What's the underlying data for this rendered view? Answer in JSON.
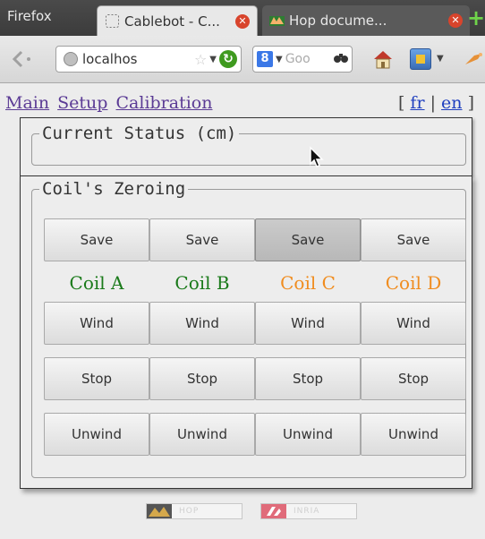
{
  "browser": {
    "app_title": "Firefox",
    "tabs": [
      {
        "label": "Cablebot - C...",
        "active": true
      },
      {
        "label": "Hop docume...",
        "active": false
      }
    ],
    "url": "localhos",
    "search_placeholder": "Goo"
  },
  "nav": {
    "links": [
      "Main",
      "Setup",
      "Calibration"
    ],
    "lang_open": "[",
    "lang_sep": "|",
    "lang_close": "]",
    "langs": [
      "fr",
      "en"
    ]
  },
  "status": {
    "legend": "Current Status (cm)"
  },
  "zeroing": {
    "legend": "Coil's Zeroing",
    "save_label": "Save",
    "wind_label": "Wind",
    "stop_label": "Stop",
    "unwind_label": "Unwind",
    "coils": [
      {
        "name": "Coil A",
        "color": "#1a7a1a"
      },
      {
        "name": "Coil B",
        "color": "#1a7a1a"
      },
      {
        "name": "Coil C",
        "color": "#f08c1e"
      },
      {
        "name": "Coil D",
        "color": "#f08c1e"
      }
    ]
  },
  "footer": {
    "logos": [
      "HOP",
      "INRIA"
    ]
  },
  "colors": {
    "link_visited": "#5b3b95",
    "link": "#1f3fbf",
    "coil_ok": "#1a7a1a",
    "coil_warn": "#f08c1e"
  }
}
